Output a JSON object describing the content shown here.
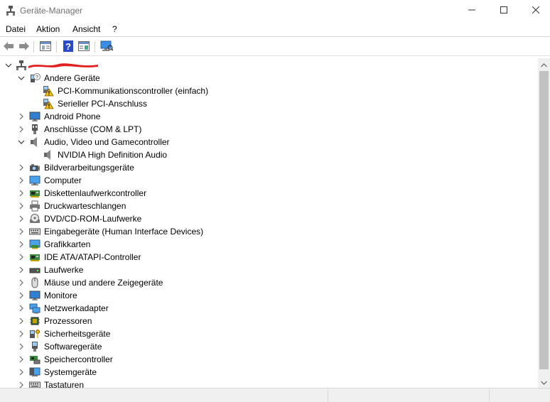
{
  "window": {
    "title": "Geräte-Manager"
  },
  "menu": [
    "Datei",
    "Aktion",
    "Ansicht",
    "?"
  ],
  "toolbar": [
    "back-icon",
    "forward-icon",
    "properties-icon",
    "help-icon",
    "show-hide-icon",
    "scan-hardware-icon"
  ],
  "tree": {
    "root_label": "",
    "rows": [
      {
        "label": "Andere Geräte",
        "state": "expanded",
        "level": 1,
        "icon": "unknown-device-icon"
      },
      {
        "label": "PCI-Kommunikationscontroller (einfach)",
        "state": "leaf",
        "level": 2,
        "icon": "warning-device-icon"
      },
      {
        "label": "Serieller PCI-Anschluss",
        "state": "leaf",
        "level": 2,
        "icon": "warning-device-icon"
      },
      {
        "label": "Android Phone",
        "state": "collapsed",
        "level": 1,
        "icon": "monitor-icon"
      },
      {
        "label": "Anschlüsse (COM & LPT)",
        "state": "collapsed",
        "level": 1,
        "icon": "port-icon"
      },
      {
        "label": "Audio, Video und Gamecontroller",
        "state": "expanded",
        "level": 1,
        "icon": "speaker-icon"
      },
      {
        "label": "NVIDIA High Definition Audio",
        "state": "leaf",
        "level": 2,
        "icon": "speaker-icon"
      },
      {
        "label": "Bildverarbeitungsgeräte",
        "state": "collapsed",
        "level": 1,
        "icon": "camera-icon"
      },
      {
        "label": "Computer",
        "state": "collapsed",
        "level": 1,
        "icon": "computer-icon"
      },
      {
        "label": "Diskettenlaufwerkcontroller",
        "state": "collapsed",
        "level": 1,
        "icon": "controller-icon"
      },
      {
        "label": "Druckwarteschlangen",
        "state": "collapsed",
        "level": 1,
        "icon": "printer-icon"
      },
      {
        "label": "DVD/CD-ROM-Laufwerke",
        "state": "collapsed",
        "level": 1,
        "icon": "disc-icon"
      },
      {
        "label": "Eingabegeräte (Human Interface Devices)",
        "state": "collapsed",
        "level": 1,
        "icon": "keyboard-icon"
      },
      {
        "label": "Grafikkarten",
        "state": "collapsed",
        "level": 1,
        "icon": "graphics-card-icon"
      },
      {
        "label": "IDE ATA/ATAPI-Controller",
        "state": "collapsed",
        "level": 1,
        "icon": "controller-icon"
      },
      {
        "label": "Laufwerke",
        "state": "collapsed",
        "level": 1,
        "icon": "drive-icon"
      },
      {
        "label": "Mäuse und andere Zeigegeräte",
        "state": "collapsed",
        "level": 1,
        "icon": "mouse-icon"
      },
      {
        "label": "Monitore",
        "state": "collapsed",
        "level": 1,
        "icon": "monitor-icon"
      },
      {
        "label": "Netzwerkadapter",
        "state": "collapsed",
        "level": 1,
        "icon": "network-icon"
      },
      {
        "label": "Prozessoren",
        "state": "collapsed",
        "level": 1,
        "icon": "processor-icon"
      },
      {
        "label": "Sicherheitsgeräte",
        "state": "collapsed",
        "level": 1,
        "icon": "security-key-icon"
      },
      {
        "label": "Softwaregeräte",
        "state": "collapsed",
        "level": 1,
        "icon": "software-device-icon"
      },
      {
        "label": "Speichercontroller",
        "state": "collapsed",
        "level": 1,
        "icon": "storage-controller-icon"
      },
      {
        "label": "Systemgeräte",
        "state": "collapsed",
        "level": 1,
        "icon": "system-device-icon"
      },
      {
        "label": "Tastaturen",
        "state": "collapsed",
        "level": 1,
        "icon": "keyboard-icon"
      }
    ]
  },
  "colors": {
    "accent": "#0078d7",
    "redaction": "#e02020",
    "warning": "#f2c200"
  }
}
